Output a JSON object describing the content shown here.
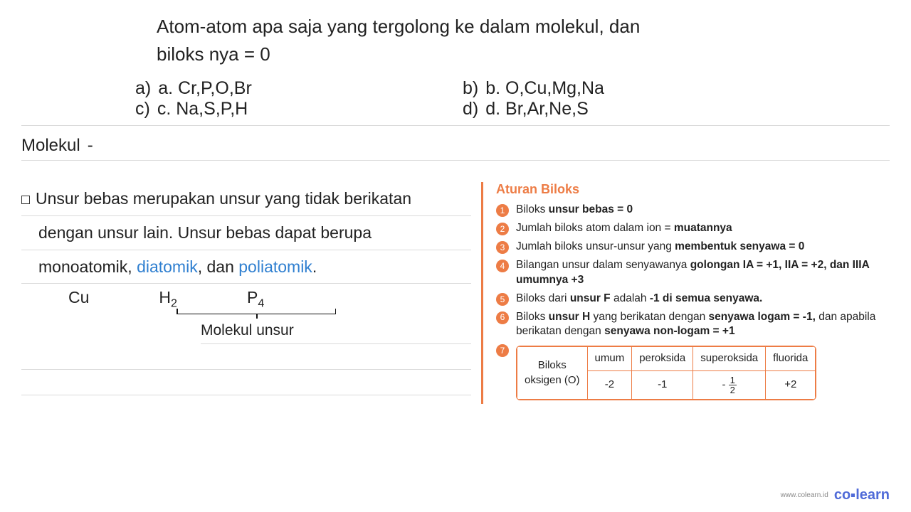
{
  "question": {
    "line1": "Atom-atom apa saja yang tergolong ke dalam molekul, dan",
    "line2": "biloks nya = 0"
  },
  "options": {
    "a_marker": "a)",
    "a_text": "a. Cr,P,O,Br",
    "b_marker": "b)",
    "b_text": "b. O,Cu,Mg,Na",
    "c_marker": "c)",
    "c_text": "c. Na,S,P,H",
    "d_marker": "d)",
    "d_text": "d. Br,Ar,Ne,S"
  },
  "molekul_label": "Molekul",
  "molekul_dash": "-",
  "explain": {
    "l1a": "Unsur bebas merupakan unsur yang tidak berikatan",
    "l2a": "dengan unsur lain.  Unsur bebas dapat berupa",
    "l3_pre": "monoatomik, ",
    "l3_di": "diatomik",
    "l3_mid": ", dan ",
    "l3_poli": "poliatomik",
    "l3_end": ".",
    "ex_cu": "Cu",
    "ex_h": "H",
    "ex_h_sub": "2",
    "ex_p": "P",
    "ex_p_sub": "4",
    "mu_label": "Molekul unsur"
  },
  "rules": {
    "title": "Aturan Biloks",
    "n1": "1",
    "n2": "2",
    "n3": "3",
    "n4": "4",
    "n5": "5",
    "n6": "6",
    "n7": "7",
    "r1_a": "Biloks ",
    "r1_b": "unsur bebas = 0",
    "r2_a": "Jumlah biloks atom dalam ion = ",
    "r2_b": "muatannya",
    "r3_a": "Jumlah biloks unsur-unsur yang ",
    "r3_b": "membentuk senyawa = 0",
    "r4_a": "Bilangan unsur dalam senyawanya ",
    "r4_b": "golongan IA = +1, IIA = +2, dan IIIA umumnya +3",
    "r5_a": "Biloks dari ",
    "r5_b": "unsur F",
    "r5_c": " adalah ",
    "r5_d": "-1 di semua senyawa.",
    "r6_a": "Biloks ",
    "r6_b": "unsur H",
    "r6_c": " yang berikatan dengan ",
    "r6_d": "senyawa logam = -1,",
    "r6_e": " dan apabila berikatan dengan ",
    "r6_f": "senyawa non-logam = +1"
  },
  "table": {
    "rowlabel1": "Biloks",
    "rowlabel2": "oksigen (O)",
    "h1": "umum",
    "h2": "peroksida",
    "h3": "superoksida",
    "h4": "fluorida",
    "v1": "-2",
    "v2": "-1",
    "v3_n": "1",
    "v3_d": "2",
    "v4": "+2"
  },
  "footer": {
    "url": "www.colearn.id",
    "brand_pre": "co",
    "brand_post": "learn"
  }
}
